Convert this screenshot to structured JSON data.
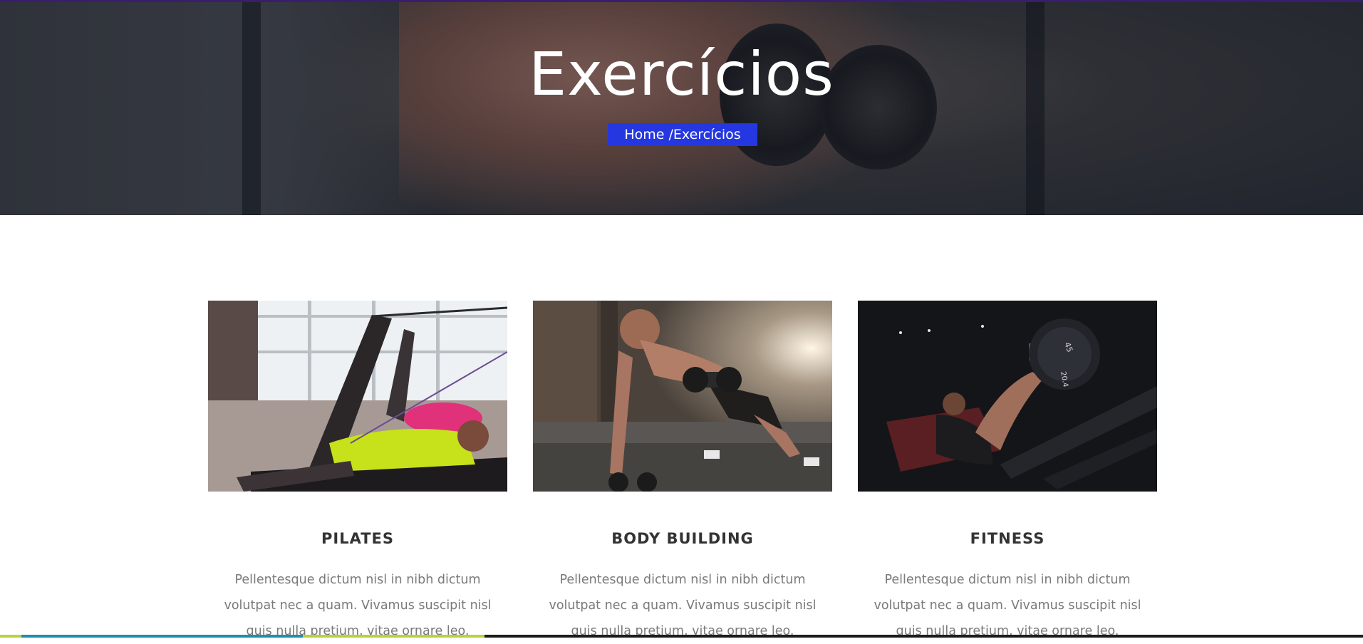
{
  "hero": {
    "title": "Exercícios",
    "breadcrumb": {
      "home": "Home",
      "separator": "/",
      "current": "Exercícios"
    }
  },
  "cards": [
    {
      "title": "PILATES",
      "text": "Pellentesque dictum nisl in nibh dictum volutpat nec a quam. Vivamus suscipit nisl quis nulla pretium, vitae ornare leo."
    },
    {
      "title": "BODY BUILDING",
      "text": "Pellentesque dictum nisl in nibh dictum volutpat nec a quam. Vivamus suscipit nisl quis nulla pretium, vitae ornare leo."
    },
    {
      "title": "FITNESS",
      "text": "Pellentesque dictum nisl in nibh dictum volutpat nec a quam. Vivamus suscipit nisl quis nulla pretium, vitae ornare leo."
    }
  ],
  "colors": {
    "breadcrumb_bg": "#2437e0",
    "heading": "#333333",
    "body_text": "#7a7a7a"
  }
}
